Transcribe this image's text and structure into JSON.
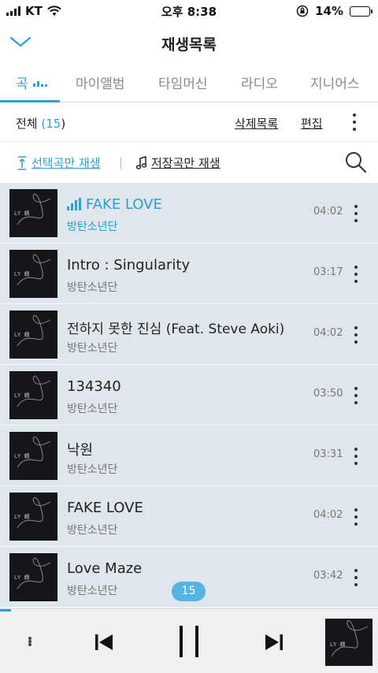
{
  "status_bar": {
    "carrier": "KT",
    "time": "오후 8:38",
    "battery_percent": "14%",
    "battery_level": 0.14
  },
  "header": {
    "title": "재생목록",
    "collapse_icon": "chevron-down-icon"
  },
  "tabs": [
    {
      "label": "곡",
      "active": true
    },
    {
      "label": "마이앨범",
      "active": false
    },
    {
      "label": "타임머신",
      "active": false
    },
    {
      "label": "라디오",
      "active": false
    },
    {
      "label": "지니어스",
      "active": false
    }
  ],
  "list_header": {
    "total_label": "전체",
    "open_paren": "(",
    "total_count": "15",
    "close_paren": ")",
    "delete_list": "삭제목록",
    "edit": "편집"
  },
  "actions": {
    "play_selected": "선택곡만 재생",
    "divider": "|",
    "play_saved": "저장곡만 재생"
  },
  "tracks": [
    {
      "title": "FAKE LOVE",
      "artist": "방탄소년단",
      "duration": "04:02",
      "playing": true
    },
    {
      "title": "Intro : Singularity",
      "artist": "방탄소년단",
      "duration": "03:17",
      "playing": false
    },
    {
      "title": "전하지 못한 진심 (Feat. Steve Aoki)",
      "artist": "방탄소년단",
      "duration": "04:02",
      "playing": false
    },
    {
      "title": "134340",
      "artist": "방탄소년단",
      "duration": "03:50",
      "playing": false
    },
    {
      "title": "낙원",
      "artist": "방탄소년단",
      "duration": "03:31",
      "playing": false
    },
    {
      "title": "FAKE LOVE",
      "artist": "방탄소년단",
      "duration": "04:02",
      "playing": false
    },
    {
      "title": "Love Maze",
      "artist": "방탄소년단",
      "duration": "03:42",
      "playing": false
    }
  ],
  "album_art_text": "LY 轉",
  "queue_badge": "15",
  "player": {
    "progress": 0.03
  },
  "colors": {
    "accent": "#2a9fd8",
    "row_bg": "#dfe6ec",
    "battery_low": "#e53935"
  }
}
